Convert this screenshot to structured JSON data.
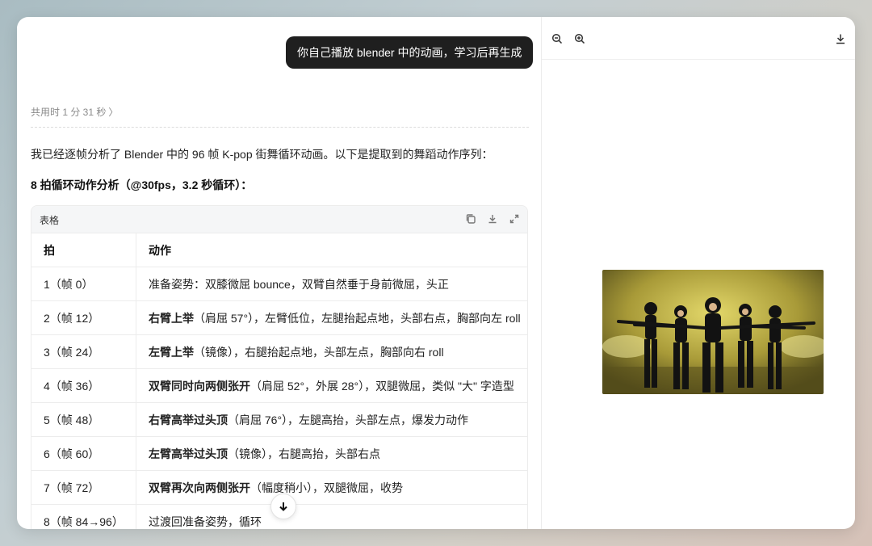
{
  "chat": {
    "user_message": "你自己播放 blender 中的动画，学习后再生成",
    "elapsed": "共用时 1 分 31 秒",
    "elapsed_chevron": "〉",
    "intro": "我已经逐帧分析了 Blender 中的 96 帧 K-pop 街舞循环动画。以下是提取到的舞蹈动作序列：",
    "subheading": "8 拍循环动作分析（@30fps，3.2 秒循环）："
  },
  "table": {
    "label": "表格",
    "headers": [
      "拍",
      "动作"
    ],
    "rows": [
      {
        "beat": "1（帧 0）",
        "bold": "",
        "action": "准备姿势：双膝微屈 bounce，双臂自然垂于身前微屈，头正"
      },
      {
        "beat": "2（帧 12）",
        "bold": "右臂上举",
        "action": "（肩屈 57°），左臂低位，左腿抬起点地，头部右点，胸部向左 roll"
      },
      {
        "beat": "3（帧 24）",
        "bold": "左臂上举",
        "action": "（镜像），右腿抬起点地，头部左点，胸部向右 roll"
      },
      {
        "beat": "4（帧 36）",
        "bold": "双臂同时向两侧张开",
        "action": "（肩屈 52°，外展 28°），双腿微屈，类似 \"大\" 字造型"
      },
      {
        "beat": "5（帧 48）",
        "bold": "右臂高举过头顶",
        "action": "（肩屈 76°），左腿高抬，头部左点，爆发力动作"
      },
      {
        "beat": "6（帧 60）",
        "bold": "左臂高举过头顶",
        "action": "（镜像），右腿高抬，头部右点"
      },
      {
        "beat": "7（帧 72）",
        "bold": "双臂再次向两侧张开",
        "action": "（幅度稍小），双腿微屈，收势"
      },
      {
        "beat": "8（帧 84→96）",
        "bold": "",
        "action": "过渡回准备姿势，循环"
      }
    ]
  },
  "icons": {
    "copy": "copy-icon",
    "download": "download-icon",
    "expand": "expand-icon",
    "zoom_out": "zoom-out-icon",
    "zoom_in": "zoom-in-icon",
    "scroll_down": "arrow-down-icon"
  },
  "colors": {
    "bubble": "#1f1f1f",
    "stage_light": "#c8b84a"
  }
}
